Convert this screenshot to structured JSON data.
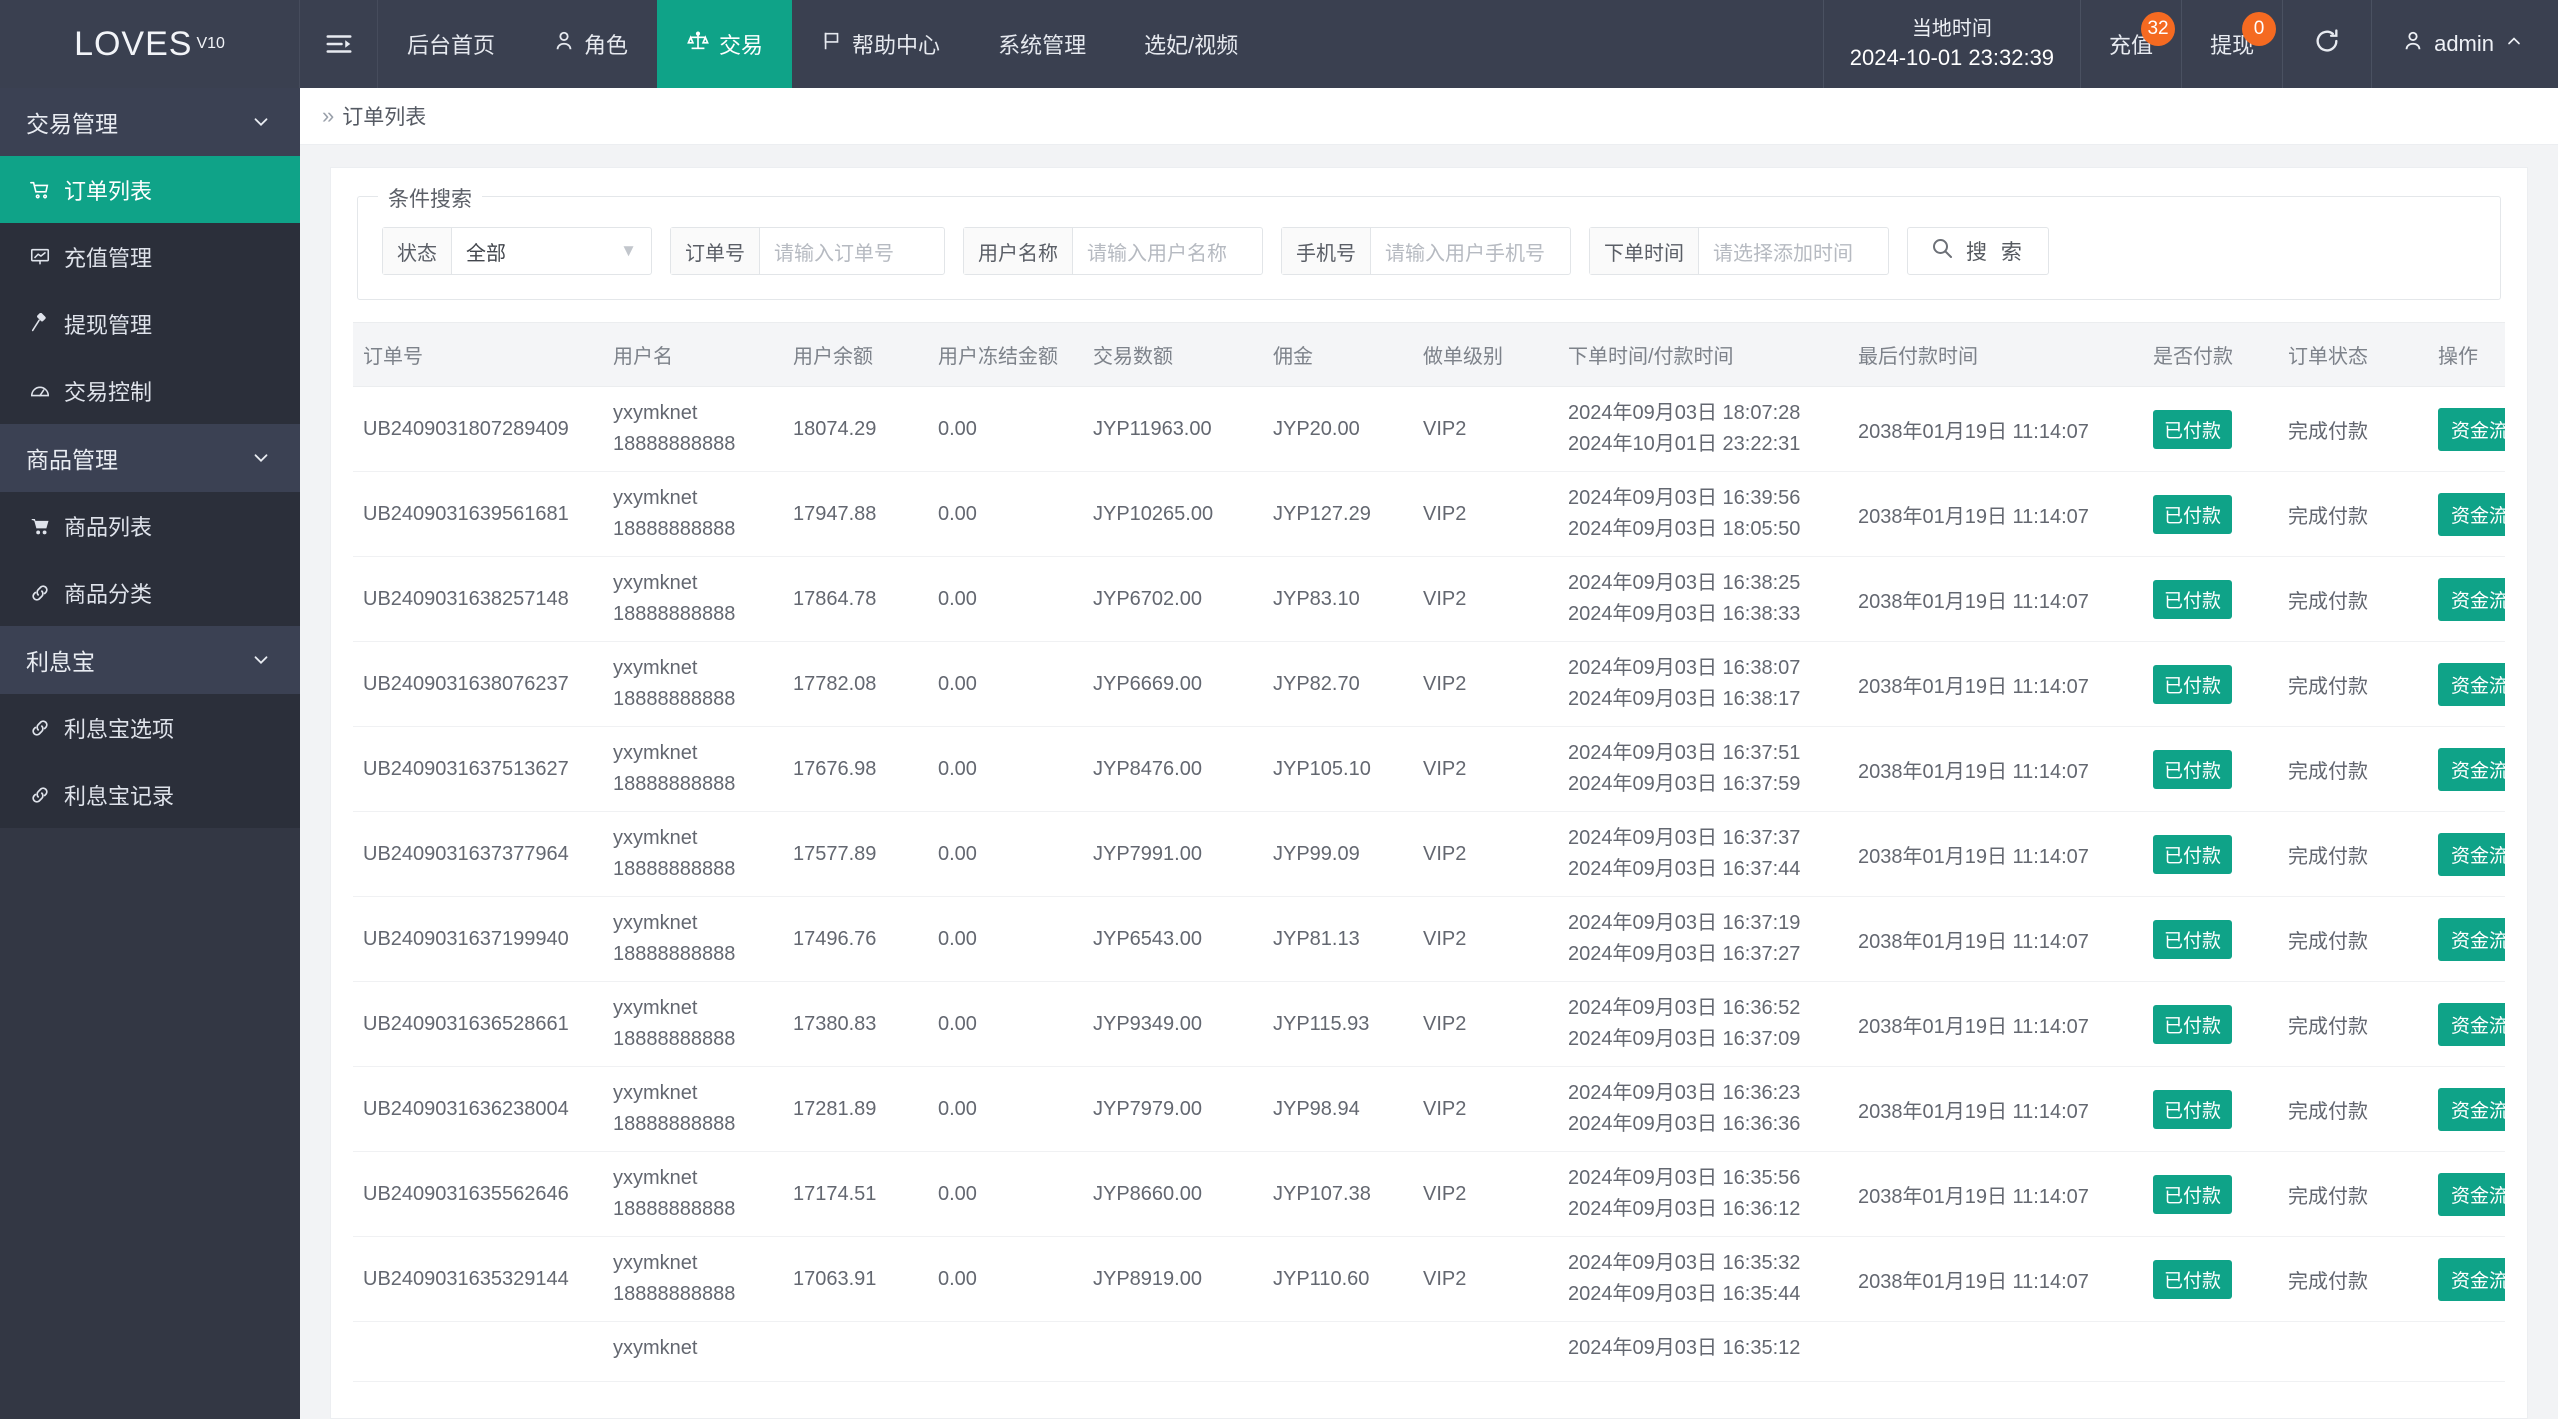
{
  "header": {
    "brand": "LOVES",
    "brand_version": "V10",
    "hamburger_icon": "menu-fold-icon",
    "nav": [
      {
        "label": "后台首页",
        "icon": "",
        "active": false
      },
      {
        "label": "角色",
        "icon": "user-icon",
        "active": false
      },
      {
        "label": "交易",
        "icon": "balance-scale-icon",
        "active": true
      },
      {
        "label": "帮助中心",
        "icon": "flag-icon",
        "active": false
      },
      {
        "label": "系统管理",
        "icon": "",
        "active": false
      },
      {
        "label": "选妃/视频",
        "icon": "",
        "active": false
      }
    ],
    "local_time_label": "当地时间",
    "local_time_value": "2024-10-01 23:32:39",
    "recharge_label": "充值",
    "recharge_badge": "32",
    "withdraw_label": "提现",
    "withdraw_badge": "0",
    "refresh_icon": "refresh-icon",
    "user_icon": "user-icon",
    "user_name": "admin",
    "user_caret": "chevron-up-icon",
    "accent_color": "#0fa388",
    "badge_color": "#f56a21",
    "bar_color": "#3a4050"
  },
  "sidebar": {
    "groups": [
      {
        "label": "交易管理",
        "chevron": "chevron-down-icon",
        "items": [
          {
            "label": "订单列表",
            "icon": "cart-arrow-icon",
            "active": true
          },
          {
            "label": "充值管理",
            "icon": "chart-board-icon",
            "active": false
          },
          {
            "label": "提现管理",
            "icon": "gavel-icon",
            "active": false
          },
          {
            "label": "交易控制",
            "icon": "gauge-icon",
            "active": false
          }
        ]
      },
      {
        "label": "商品管理",
        "chevron": "chevron-down-icon",
        "items": [
          {
            "label": "商品列表",
            "icon": "cart-icon",
            "active": false
          },
          {
            "label": "商品分类",
            "icon": "link-icon",
            "active": false
          }
        ]
      },
      {
        "label": "利息宝",
        "chevron": "chevron-down-icon",
        "items": [
          {
            "label": "利息宝选项",
            "icon": "link-icon",
            "active": false
          },
          {
            "label": "利息宝记录",
            "icon": "link-icon",
            "active": false
          }
        ]
      }
    ]
  },
  "breadcrumb": {
    "arrow": "»",
    "current": "订单列表"
  },
  "search": {
    "legend": "条件搜索",
    "status_label": "状态",
    "status_value": "全部",
    "status_caret": "caret-down-icon",
    "order_label": "订单号",
    "order_placeholder": "请输入订单号",
    "order_value": "",
    "username_label": "用户名称",
    "username_placeholder": "请输入用户名称",
    "username_value": "",
    "phone_label": "手机号",
    "phone_placeholder": "请输入用户手机号",
    "phone_value": "",
    "time_label": "下单时间",
    "time_placeholder": "请选择添加时间",
    "time_value": "",
    "search_button": "搜 索",
    "search_icon": "search-icon"
  },
  "table": {
    "columns": [
      "订单号",
      "用户名",
      "用户余额",
      "用户冻结金额",
      "交易数额",
      "佣金",
      "做单级别",
      "下单时间/付款时间",
      "最后付款时间",
      "是否付款",
      "订单状态",
      "操作"
    ],
    "rows": [
      {
        "order_no": "UB2409031807289409",
        "user_name": "yxymknet",
        "user_phone": "18888888888",
        "balance": "18074.29",
        "frozen": "0.00",
        "amount": "JYP11963.00",
        "commission": "JYP20.00",
        "level": "VIP2",
        "order_time": "2024年09月03日 18:07:28",
        "pay_time": "2024年10月01日 23:22:31",
        "last_pay_time": "2038年01月19日 11:14:07",
        "paid": "已付款",
        "status": "完成付款",
        "action": "资金流水"
      },
      {
        "order_no": "UB2409031639561681",
        "user_name": "yxymknet",
        "user_phone": "18888888888",
        "balance": "17947.88",
        "frozen": "0.00",
        "amount": "JYP10265.00",
        "commission": "JYP127.29",
        "level": "VIP2",
        "order_time": "2024年09月03日 16:39:56",
        "pay_time": "2024年09月03日 18:05:50",
        "last_pay_time": "2038年01月19日 11:14:07",
        "paid": "已付款",
        "status": "完成付款",
        "action": "资金流水"
      },
      {
        "order_no": "UB2409031638257148",
        "user_name": "yxymknet",
        "user_phone": "18888888888",
        "balance": "17864.78",
        "frozen": "0.00",
        "amount": "JYP6702.00",
        "commission": "JYP83.10",
        "level": "VIP2",
        "order_time": "2024年09月03日 16:38:25",
        "pay_time": "2024年09月03日 16:38:33",
        "last_pay_time": "2038年01月19日 11:14:07",
        "paid": "已付款",
        "status": "完成付款",
        "action": "资金流水"
      },
      {
        "order_no": "UB2409031638076237",
        "user_name": "yxymknet",
        "user_phone": "18888888888",
        "balance": "17782.08",
        "frozen": "0.00",
        "amount": "JYP6669.00",
        "commission": "JYP82.70",
        "level": "VIP2",
        "order_time": "2024年09月03日 16:38:07",
        "pay_time": "2024年09月03日 16:38:17",
        "last_pay_time": "2038年01月19日 11:14:07",
        "paid": "已付款",
        "status": "完成付款",
        "action": "资金流水"
      },
      {
        "order_no": "UB2409031637513627",
        "user_name": "yxymknet",
        "user_phone": "18888888888",
        "balance": "17676.98",
        "frozen": "0.00",
        "amount": "JYP8476.00",
        "commission": "JYP105.10",
        "level": "VIP2",
        "order_time": "2024年09月03日 16:37:51",
        "pay_time": "2024年09月03日 16:37:59",
        "last_pay_time": "2038年01月19日 11:14:07",
        "paid": "已付款",
        "status": "完成付款",
        "action": "资金流水"
      },
      {
        "order_no": "UB2409031637377964",
        "user_name": "yxymknet",
        "user_phone": "18888888888",
        "balance": "17577.89",
        "frozen": "0.00",
        "amount": "JYP7991.00",
        "commission": "JYP99.09",
        "level": "VIP2",
        "order_time": "2024年09月03日 16:37:37",
        "pay_time": "2024年09月03日 16:37:44",
        "last_pay_time": "2038年01月19日 11:14:07",
        "paid": "已付款",
        "status": "完成付款",
        "action": "资金流水"
      },
      {
        "order_no": "UB2409031637199940",
        "user_name": "yxymknet",
        "user_phone": "18888888888",
        "balance": "17496.76",
        "frozen": "0.00",
        "amount": "JYP6543.00",
        "commission": "JYP81.13",
        "level": "VIP2",
        "order_time": "2024年09月03日 16:37:19",
        "pay_time": "2024年09月03日 16:37:27",
        "last_pay_time": "2038年01月19日 11:14:07",
        "paid": "已付款",
        "status": "完成付款",
        "action": "资金流水"
      },
      {
        "order_no": "UB2409031636528661",
        "user_name": "yxymknet",
        "user_phone": "18888888888",
        "balance": "17380.83",
        "frozen": "0.00",
        "amount": "JYP9349.00",
        "commission": "JYP115.93",
        "level": "VIP2",
        "order_time": "2024年09月03日 16:36:52",
        "pay_time": "2024年09月03日 16:37:09",
        "last_pay_time": "2038年01月19日 11:14:07",
        "paid": "已付款",
        "status": "完成付款",
        "action": "资金流水"
      },
      {
        "order_no": "UB2409031636238004",
        "user_name": "yxymknet",
        "user_phone": "18888888888",
        "balance": "17281.89",
        "frozen": "0.00",
        "amount": "JYP7979.00",
        "commission": "JYP98.94",
        "level": "VIP2",
        "order_time": "2024年09月03日 16:36:23",
        "pay_time": "2024年09月03日 16:36:36",
        "last_pay_time": "2038年01月19日 11:14:07",
        "paid": "已付款",
        "status": "完成付款",
        "action": "资金流水"
      },
      {
        "order_no": "UB2409031635562646",
        "user_name": "yxymknet",
        "user_phone": "18888888888",
        "balance": "17174.51",
        "frozen": "0.00",
        "amount": "JYP8660.00",
        "commission": "JYP107.38",
        "level": "VIP2",
        "order_time": "2024年09月03日 16:35:56",
        "pay_time": "2024年09月03日 16:36:12",
        "last_pay_time": "2038年01月19日 11:14:07",
        "paid": "已付款",
        "status": "完成付款",
        "action": "资金流水"
      },
      {
        "order_no": "UB2409031635329144",
        "user_name": "yxymknet",
        "user_phone": "18888888888",
        "balance": "17063.91",
        "frozen": "0.00",
        "amount": "JYP8919.00",
        "commission": "JYP110.60",
        "level": "VIP2",
        "order_time": "2024年09月03日 16:35:32",
        "pay_time": "2024年09月03日 16:35:44",
        "last_pay_time": "2038年01月19日 11:14:07",
        "paid": "已付款",
        "status": "完成付款",
        "action": "资金流水"
      },
      {
        "order_no": "",
        "user_name": "yxymknet",
        "user_phone": "",
        "balance": "",
        "frozen": "",
        "amount": "",
        "commission": "",
        "level": "",
        "order_time": "2024年09月03日 16:35:12",
        "pay_time": "",
        "last_pay_time": "",
        "paid": "",
        "status": "",
        "action": ""
      }
    ]
  }
}
